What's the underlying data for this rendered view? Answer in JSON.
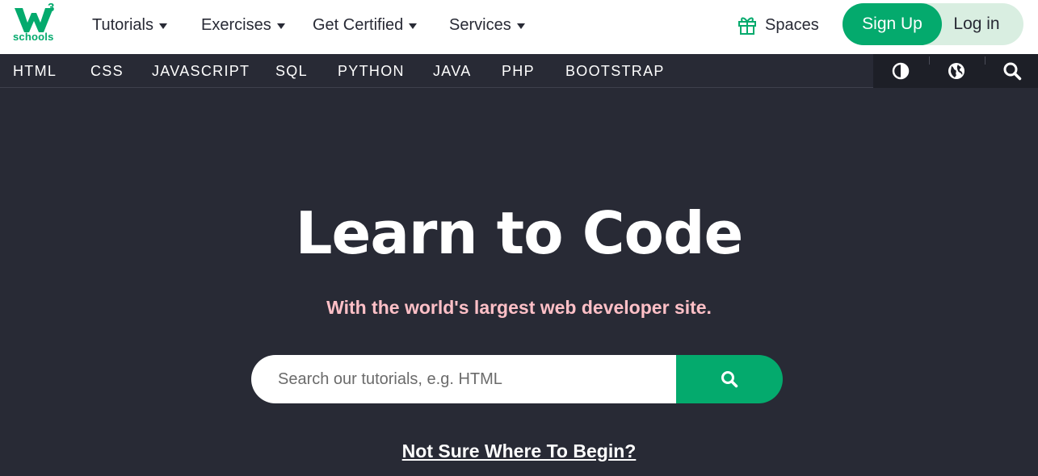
{
  "logo": {
    "sup": "3",
    "text": "schools"
  },
  "nav": {
    "menu": [
      {
        "label": "Tutorials"
      },
      {
        "label": "Exercises"
      },
      {
        "label": "Get Certified"
      },
      {
        "label": "Services"
      }
    ],
    "spaces_label": "Spaces",
    "signup_label": "Sign Up",
    "login_label": "Log in"
  },
  "subnav": {
    "items": [
      "HTML",
      "CSS",
      "JAVASCRIPT",
      "SQL",
      "PYTHON",
      "JAVA",
      "PHP",
      "BOOTSTRAP"
    ],
    "tools": [
      "contrast-icon",
      "globe-icon",
      "search-icon"
    ]
  },
  "hero": {
    "title": "Learn to Code",
    "subtitle": "With the world's largest web developer site.",
    "search_placeholder": "Search our tutorials, e.g. HTML",
    "begin_link": "Not Sure Where To Begin?"
  },
  "colors": {
    "brand": "#04aa6d",
    "dark_bg": "#282a35",
    "subtitle_pink": "#ffc0c7"
  }
}
